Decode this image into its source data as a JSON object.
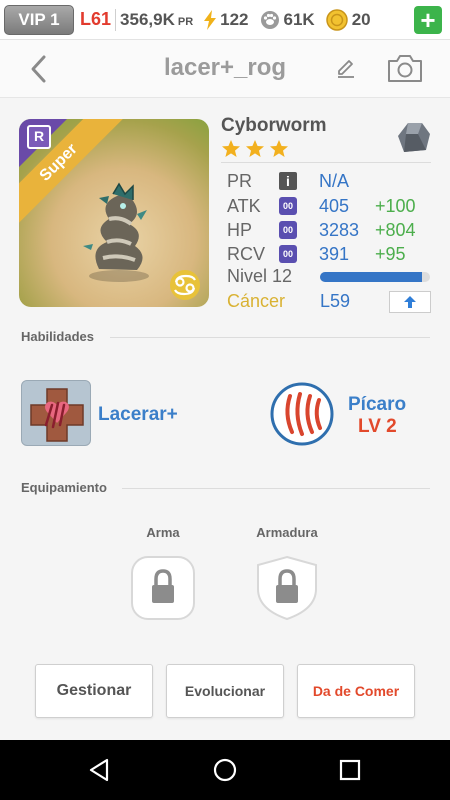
{
  "status": {
    "vip": "VIP 1",
    "level": "L61",
    "pr_value": "356,9K",
    "pr_unit": "PR",
    "energy": "122",
    "paws": "61K",
    "coins": "20",
    "plus_label": "+"
  },
  "header": {
    "title": "lacer+_rog"
  },
  "monster": {
    "badge": "R",
    "ribbon": "Super",
    "name": "Cyborworm",
    "stars": 3,
    "stats": [
      {
        "label": "PR",
        "value": "N/A",
        "bonus": ""
      },
      {
        "label": "ATK",
        "value": "405",
        "bonus": "+100"
      },
      {
        "label": "HP",
        "value": "3283",
        "bonus": "+804"
      },
      {
        "label": "RCV",
        "value": "391",
        "bonus": "+95"
      }
    ],
    "stat_icon_text": "00",
    "level_label": "Nivel 12",
    "xp_fraction": 0.93,
    "sign": "Cáncer",
    "max_level": "L59"
  },
  "sections": {
    "skills": "Habilidades",
    "equipment": "Equipamiento"
  },
  "skill": {
    "name": "Lacerar+"
  },
  "class": {
    "name": "Pícaro",
    "level": "LV 2"
  },
  "equipment": {
    "weapon": "Arma",
    "armor": "Armadura"
  },
  "buttons": {
    "manage": "Gestionar",
    "evolve": "Evolucionar",
    "feed": "Da de Comer"
  },
  "colors": {
    "accent_blue": "#3575c6",
    "bonus_green": "#4cae4c",
    "level_red": "#e23b2e",
    "feed_orange": "#e2492b"
  }
}
